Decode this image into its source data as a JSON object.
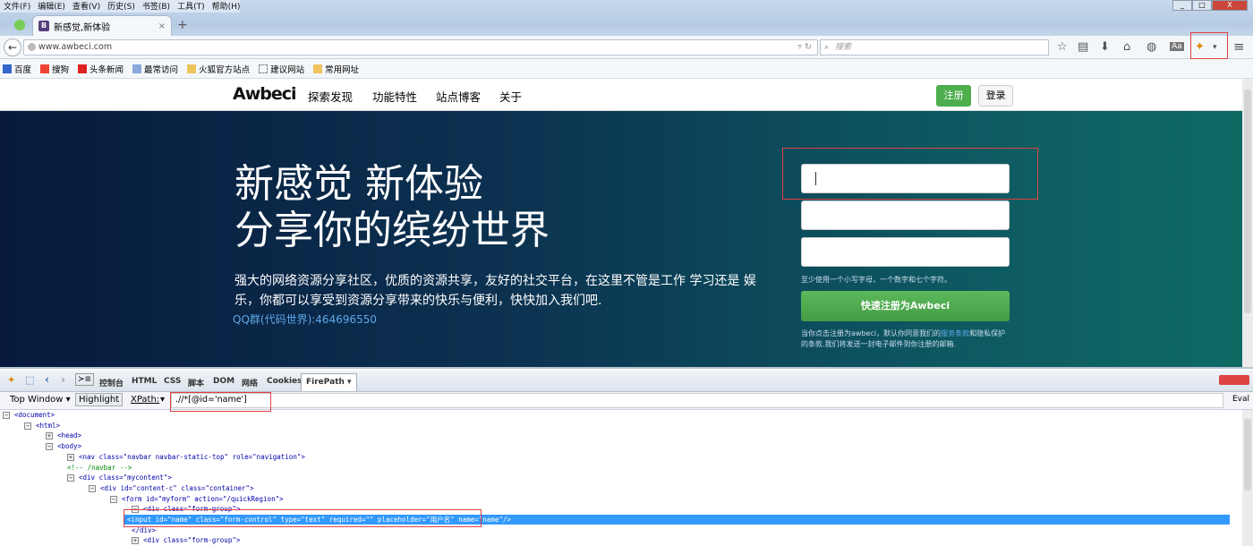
{
  "menu": [
    "文件(F)",
    "编辑(E)",
    "查看(V)",
    "历史(S)",
    "书签(B)",
    "工具(T)",
    "帮助(H)"
  ],
  "tab": {
    "title": "新感觉,新体验",
    "favicon": "B",
    "close": "×",
    "new": "+"
  },
  "url": "www.awbeci.com",
  "search_placeholder": "搜索",
  "bookmarks": [
    "百度",
    "搜狗",
    "头条新闻",
    "最常访问",
    "火狐官方站点",
    "建议网站",
    "常用网址"
  ],
  "site": {
    "brand": "Awbeci",
    "nav": [
      "探索发现",
      "功能特性",
      "站点博客",
      "关于"
    ],
    "register": "注册",
    "login": "登录",
    "headline1": "新感觉 新体验",
    "headline2": "分享你的缤纷世界",
    "desc": "强大的网络资源分享社区，优质的资源共享，友好的社交平台，在这里不管是工作 学习还是 娱乐，你都可以享受到资源分享带来的快乐与便利，快快加入我们吧.",
    "qq": "QQ群(代码世界):464696550",
    "password_hint": "至少使用一个小写字母，一个数字和七个字符。",
    "signup_button": "快速注册为Awbeci",
    "terms_pre": "当你点击注册为awbeci，默认你同意我们的",
    "terms_link": "服务条款",
    "terms_post": "和隐私保护的条款.我们将发送一封电子邮件到你注册的邮箱."
  },
  "devtools": {
    "tabs": [
      "控制台",
      "HTML",
      "CSS",
      "脚本",
      "DOM",
      "网络",
      "Cookies",
      "FirePath ▾"
    ],
    "top_window": "Top Window ▾",
    "highlight": "Highlight",
    "xpath_label": "XPath:",
    "xpath_value": ".//*[@id='name']",
    "eval": "Eval",
    "tree": [
      {
        "indent": 0,
        "ex": "−",
        "text": "<document>"
      },
      {
        "indent": 1,
        "ex": "−",
        "text": "<html>"
      },
      {
        "indent": 2,
        "ex": "+",
        "text": "<head>"
      },
      {
        "indent": 2,
        "ex": "−",
        "text": "<body>"
      },
      {
        "indent": 3,
        "ex": "+",
        "text": "<nav class=\"navbar navbar-static-top\" role=\"navigation\">"
      },
      {
        "indent": 3,
        "ex": "",
        "text": "<!-- /navbar -->"
      },
      {
        "indent": 3,
        "ex": "−",
        "text": "<div class=\"mycontent\">"
      },
      {
        "indent": 4,
        "ex": "−",
        "text": "<div id=\"content-c\" class=\"container\">"
      },
      {
        "indent": 5,
        "ex": "−",
        "text": "<form id=\"myform\" action=\"/quickRegion\">"
      },
      {
        "indent": 6,
        "ex": "−",
        "text": "<div class=\"form-group\">"
      },
      {
        "indent": 7,
        "ex": "",
        "text": "<input id=\"name\" class=\"form-control\" type=\"text\" required=\"\" placeholder=\"用户名\" name=\"name\"/>"
      },
      {
        "indent": 6,
        "ex": "",
        "text": "</div>"
      },
      {
        "indent": 6,
        "ex": "+",
        "text": "<div class=\"form-group\">"
      }
    ]
  }
}
